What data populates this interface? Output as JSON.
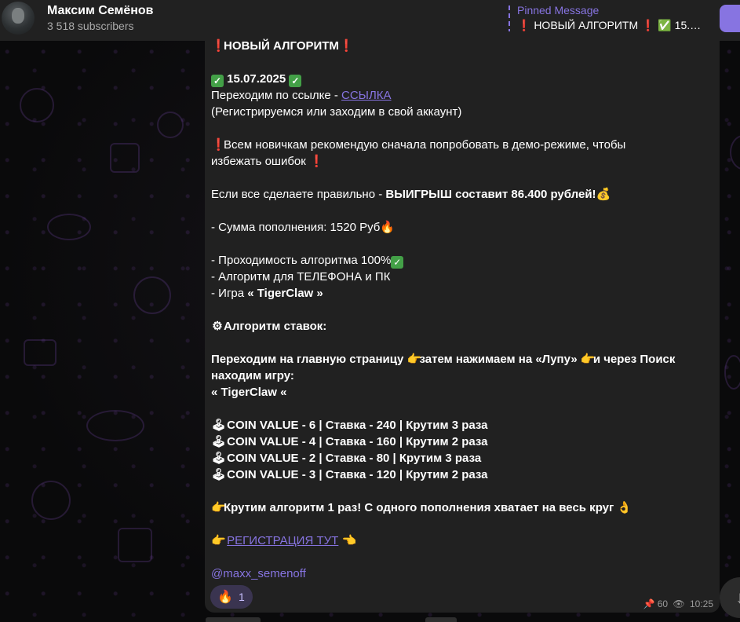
{
  "header": {
    "title": "Максим Семёнов",
    "subtitle": "3 518 subscribers",
    "pinned_title": "Pinned Message",
    "pinned_text": "❗ НОВЫЙ АЛГОРИТМ ❗ ✅ 15.07...."
  },
  "message": {
    "heading": "НОВЫЙ АЛГОРИТМ",
    "date": "15.07.2025",
    "link_prefix": "Переходим по ссылке - ",
    "link_text": "ССЫЛКА",
    "register_note": "(Регистрируемся или заходим в свой аккаунт)",
    "demo_warning_1": "Всем новичкам рекомендую сначала попробовать в демо-режиме, чтобы",
    "demo_warning_2": "избежать ошибок ",
    "win_prefix": "Если все сделаете правильно - ",
    "win_bold": "ВЫИГРЫШ составит 86.400 рублей!",
    "deposit": "- Сумма пополнения: 1520 Руб",
    "pass_rate": "- Проходимость алгоритма 100%",
    "platform": "- Алгоритм для ТЕЛЕФОНА и ПК",
    "game_prefix": "- Игра ",
    "game_name": "« TigerClaw »",
    "algo_title": "Алгоритм ставок:",
    "step_1": "Переходим на главную страницу ",
    "step_2": "затем нажимаем на «Лупу» ",
    "step_3": "и через Поиск",
    "step_4": "находим игру:",
    "step_game": "« TigerClaw «",
    "bets": [
      "COIN VALUE -  6  | Ставка - 240 | Крутим 3 раза",
      "COIN VALUE -  4  | Ставка - 160 | Крутим 2 раза",
      "COIN VALUE -  2  | Ставка - 80   | Крутим 3 раза",
      "COIN VALUE -  3  | Ставка - 120 | Крутим 2 раза"
    ],
    "spin_note": "Крутим алгоритм 1 раз! С одного пополнения хватает на весь круг ",
    "register_link": "РЕГИСТРАЦИЯ ТУТ",
    "mention": "@maxx_semenoff"
  },
  "reaction": {
    "emoji": "🔥",
    "count": "1"
  },
  "meta": {
    "pins": "60",
    "time": "10:25"
  },
  "colors": {
    "accent": "#8774e1",
    "bubble": "#212121",
    "header": "#212121"
  },
  "icons": {
    "exclamation": "❗",
    "check": "✓",
    "money": "💰",
    "fire": "🔥",
    "gear": "⚙",
    "point_right": "👉",
    "joystick": "🕹",
    "ok_hand": "👌",
    "point_left": "👈",
    "pin": "📌",
    "eye": "👁",
    "arrow_down": "↓"
  }
}
